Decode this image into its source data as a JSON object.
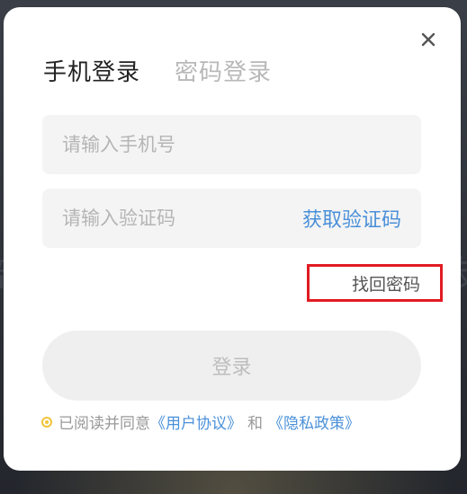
{
  "background": {
    "left_glyph": "部",
    "right_glyph": "友"
  },
  "dialog": {
    "close_icon": "close-icon",
    "tabs": [
      {
        "label": "手机登录",
        "active": true
      },
      {
        "label": "密码登录",
        "active": false
      }
    ],
    "phone": {
      "placeholder": "请输入手机号",
      "value": ""
    },
    "code": {
      "placeholder": "请输入验证码",
      "value": "",
      "get_code_label": "获取验证码"
    },
    "forgot_label": "找回密码",
    "login_label": "登录",
    "agreement": {
      "prefix": "已阅读并同意",
      "user_agreement": "《用户协议》",
      "and": "和",
      "privacy_policy": "《隐私政策》"
    }
  },
  "colors": {
    "accent_link": "#4a90d9",
    "highlight_border": "#e11b22",
    "radio": "#f0c43a"
  }
}
